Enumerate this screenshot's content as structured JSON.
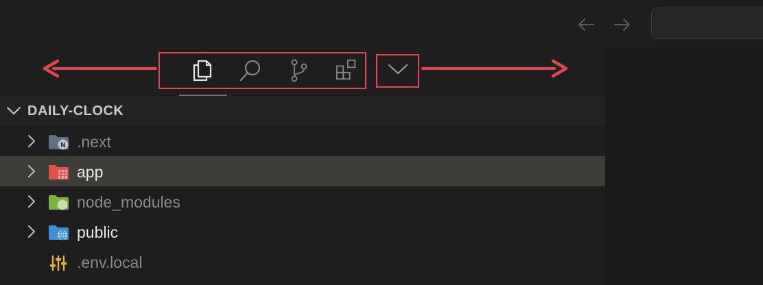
{
  "titlebar": {
    "back_icon": "arrow-left-icon",
    "forward_icon": "arrow-right-icon"
  },
  "activity_bar": {
    "items": [
      {
        "icon": "explorer-files-icon",
        "active": true
      },
      {
        "icon": "search-icon",
        "active": false
      },
      {
        "icon": "source-control-icon",
        "active": false
      },
      {
        "icon": "extensions-icon",
        "active": false
      }
    ],
    "more_icon": "chevron-down-icon"
  },
  "annotation": {
    "color": "#e0474c"
  },
  "explorer": {
    "root_label": "DAILY-CLOCK",
    "items": [
      {
        "label": ".next",
        "icon": "nextjs-folder-icon",
        "color": "#8a8a8a",
        "expandable": true,
        "selected": false
      },
      {
        "label": "app",
        "icon": "app-folder-icon",
        "color": "#e8e8e8",
        "expandable": true,
        "selected": true
      },
      {
        "label": "node_modules",
        "icon": "node-folder-icon",
        "color": "#8a8a8a",
        "expandable": true,
        "selected": false
      },
      {
        "label": "public",
        "icon": "public-folder-icon",
        "color": "#e8e8e8",
        "expandable": true,
        "selected": false
      },
      {
        "label": ".env.local",
        "icon": "settings-sliders-icon",
        "color": "#8a8a8a",
        "expandable": false,
        "selected": false
      }
    ]
  }
}
